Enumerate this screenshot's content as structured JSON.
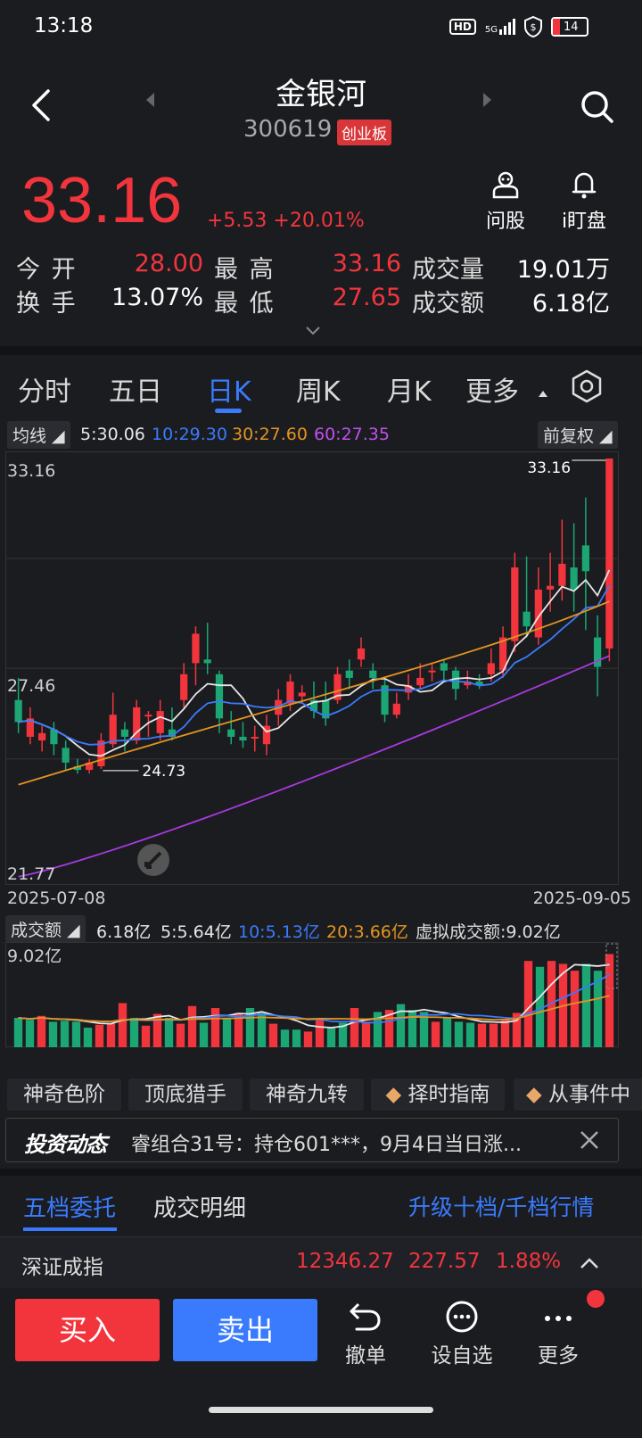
{
  "status": {
    "time": "13:18",
    "hd": "HD",
    "network": "5G",
    "battery": "14"
  },
  "header": {
    "name": "金银河",
    "code": "300619",
    "board": "创业板"
  },
  "price": {
    "last": "33.16",
    "change": "+5.53 +20.01%"
  },
  "actions": {
    "wengu": "问股",
    "dingpan": "i盯盘"
  },
  "quote": {
    "open_label": "今  开",
    "open": "28.00",
    "high_label": "最  高",
    "high": "33.16",
    "volume_label": "成交量",
    "volume": "19.01万",
    "turnover_label": "换  手",
    "turnover": "13.07%",
    "low_label": "最  低",
    "low": "27.65",
    "amount_label": "成交额",
    "amount": "6.18亿"
  },
  "tabs": [
    "分时",
    "五日",
    "日K",
    "周K",
    "月K",
    "更多"
  ],
  "ma": {
    "label": "均线",
    "ma5": "5:30.06",
    "ma10": "10:29.30",
    "ma30": "30:27.60",
    "ma60": "60:27.35",
    "adjust": "前复权"
  },
  "kline": {
    "y_top": "33.16",
    "y_mid": "27.46",
    "y_bottom": "21.77",
    "max_label": "33.16",
    "min_label": "24.73",
    "start_date": "2025-07-08",
    "end_date": "2025-09-05",
    "colors": {
      "up": "#f2353d",
      "down": "#1ba673",
      "ma5": "#e6e6e6",
      "ma10": "#3a7bfd",
      "ma30": "#e39420",
      "ma60": "#a83ae0"
    }
  },
  "volume": {
    "label": "成交额",
    "value": "6.18亿",
    "ma5": "5:5.64亿",
    "ma10": "10:5.13亿",
    "ma20": "20:3.66亿",
    "virtual": "虚拟成交额:9.02亿",
    "y_top": "9.02亿"
  },
  "features": [
    "神奇色阶",
    "顶底猎手",
    "神奇九转",
    "择时指南",
    "从事件中"
  ],
  "news": {
    "logo": "投资动态",
    "text": "睿组合31号：持仓601***，9月4日当日涨..."
  },
  "order_tabs": {
    "tab1": "五档委托",
    "tab2": "成交明细",
    "upgrade": "升级十档/千档行情"
  },
  "index": {
    "name": "深证成指",
    "value": "12346.27",
    "change": "227.57",
    "pct": "1.88%"
  },
  "bottom": {
    "buy": "买入",
    "sell": "卖出",
    "cancel": "撤单",
    "watch": "设自选",
    "more": "更多"
  },
  "chart_data": {
    "type": "candlestick",
    "title": "",
    "x_range": [
      "2025-07-08",
      "2025-09-05"
    ],
    "ylim": [
      21.77,
      33.16
    ],
    "candles": [
      {
        "o": 26.6,
        "c": 26.0,
        "h": 27.2,
        "l": 25.7
      },
      {
        "o": 25.6,
        "c": 26.1,
        "h": 26.4,
        "l": 25.4
      },
      {
        "o": 25.5,
        "c": 25.7,
        "h": 25.9,
        "l": 25.2
      },
      {
        "o": 25.8,
        "c": 25.4,
        "h": 26.0,
        "l": 25.1
      },
      {
        "o": 25.3,
        "c": 24.9,
        "h": 25.5,
        "l": 24.7
      },
      {
        "o": 24.8,
        "c": 24.7,
        "h": 25.0,
        "l": 24.6
      },
      {
        "o": 24.7,
        "c": 24.9,
        "h": 25.0,
        "l": 24.6
      },
      {
        "o": 24.8,
        "c": 25.5,
        "h": 25.7,
        "l": 24.73
      },
      {
        "o": 25.4,
        "c": 26.2,
        "h": 26.8,
        "l": 25.3
      },
      {
        "o": 25.8,
        "c": 25.6,
        "h": 26.0,
        "l": 25.2
      },
      {
        "o": 25.5,
        "c": 26.4,
        "h": 26.6,
        "l": 25.4
      },
      {
        "o": 26.2,
        "c": 26.2,
        "h": 26.3,
        "l": 25.6
      },
      {
        "o": 25.7,
        "c": 26.3,
        "h": 26.6,
        "l": 25.5
      },
      {
        "o": 25.8,
        "c": 25.6,
        "h": 26.4,
        "l": 25.5
      },
      {
        "o": 26.6,
        "c": 27.3,
        "h": 27.6,
        "l": 26.4
      },
      {
        "o": 27.6,
        "c": 28.4,
        "h": 28.6,
        "l": 27.0
      },
      {
        "o": 27.7,
        "c": 27.6,
        "h": 28.7,
        "l": 27.3
      },
      {
        "o": 27.3,
        "c": 26.1,
        "h": 27.4,
        "l": 25.7
      },
      {
        "o": 25.8,
        "c": 25.6,
        "h": 26.3,
        "l": 25.4
      },
      {
        "o": 25.6,
        "c": 25.5,
        "h": 26.0,
        "l": 25.3
      },
      {
        "o": 25.6,
        "c": 25.6,
        "h": 25.9,
        "l": 25.2
      },
      {
        "o": 25.4,
        "c": 25.9,
        "h": 26.2,
        "l": 25.1
      },
      {
        "o": 26.2,
        "c": 26.6,
        "h": 26.9,
        "l": 25.9
      },
      {
        "o": 26.5,
        "c": 27.1,
        "h": 27.3,
        "l": 26.3
      },
      {
        "o": 26.7,
        "c": 26.8,
        "h": 27.0,
        "l": 26.5
      },
      {
        "o": 26.6,
        "c": 26.3,
        "h": 27.1,
        "l": 26.1
      },
      {
        "o": 26.6,
        "c": 26.1,
        "h": 27.1,
        "l": 25.9
      },
      {
        "o": 26.6,
        "c": 27.3,
        "h": 27.5,
        "l": 26.5
      },
      {
        "o": 27.4,
        "c": 27.2,
        "h": 27.7,
        "l": 26.9
      },
      {
        "o": 27.7,
        "c": 28.0,
        "h": 28.3,
        "l": 27.5
      },
      {
        "o": 27.4,
        "c": 27.2,
        "h": 27.6,
        "l": 26.9
      },
      {
        "o": 27.0,
        "c": 26.2,
        "h": 27.2,
        "l": 26.0
      },
      {
        "o": 26.2,
        "c": 26.5,
        "h": 26.8,
        "l": 26.1
      },
      {
        "o": 26.8,
        "c": 27.0,
        "h": 27.3,
        "l": 26.6
      },
      {
        "o": 27.0,
        "c": 27.2,
        "h": 27.6,
        "l": 26.9
      },
      {
        "o": 27.4,
        "c": 27.4,
        "h": 27.6,
        "l": 27.1
      },
      {
        "o": 27.6,
        "c": 27.4,
        "h": 27.7,
        "l": 27.1
      },
      {
        "o": 27.4,
        "c": 26.9,
        "h": 27.5,
        "l": 26.6
      },
      {
        "o": 27.0,
        "c": 27.1,
        "h": 27.4,
        "l": 26.9
      },
      {
        "o": 27.1,
        "c": 27.0,
        "h": 27.3,
        "l": 26.9
      },
      {
        "o": 27.3,
        "c": 27.6,
        "h": 28.0,
        "l": 27.1
      },
      {
        "o": 27.4,
        "c": 28.3,
        "h": 28.6,
        "l": 27.2
      },
      {
        "o": 28.2,
        "c": 30.2,
        "h": 30.6,
        "l": 27.9
      },
      {
        "o": 29.0,
        "c": 28.6,
        "h": 30.5,
        "l": 28.3
      },
      {
        "o": 28.3,
        "c": 29.6,
        "h": 30.2,
        "l": 28.1
      },
      {
        "o": 29.6,
        "c": 29.7,
        "h": 30.6,
        "l": 29.0
      },
      {
        "o": 29.7,
        "c": 30.3,
        "h": 31.5,
        "l": 29.3
      },
      {
        "o": 30.2,
        "c": 29.6,
        "h": 31.4,
        "l": 29.0
      },
      {
        "o": 30.8,
        "c": 30.1,
        "h": 32.1,
        "l": 28.5
      },
      {
        "o": 28.3,
        "c": 27.5,
        "h": 28.9,
        "l": 26.7
      },
      {
        "o": 28.0,
        "c": 33.16,
        "h": 33.16,
        "l": 27.65
      }
    ],
    "volume_bars": [
      {
        "v": 0.3,
        "up": false
      },
      {
        "v": 0.28,
        "up": false
      },
      {
        "v": 0.32,
        "up": true
      },
      {
        "v": 0.26,
        "up": false
      },
      {
        "v": 0.27,
        "up": false
      },
      {
        "v": 0.26,
        "up": false
      },
      {
        "v": 0.2,
        "up": false
      },
      {
        "v": 0.23,
        "up": true
      },
      {
        "v": 0.24,
        "up": true
      },
      {
        "v": 0.45,
        "up": true
      },
      {
        "v": 0.3,
        "up": false
      },
      {
        "v": 0.22,
        "up": true
      },
      {
        "v": 0.34,
        "up": true
      },
      {
        "v": 0.3,
        "up": false
      },
      {
        "v": 0.24,
        "up": true
      },
      {
        "v": 0.42,
        "up": true
      },
      {
        "v": 0.25,
        "up": false
      },
      {
        "v": 0.4,
        "up": true
      },
      {
        "v": 0.3,
        "up": false
      },
      {
        "v": 0.35,
        "up": true
      },
      {
        "v": 0.4,
        "up": false
      },
      {
        "v": 0.36,
        "up": false
      },
      {
        "v": 0.24,
        "up": true
      },
      {
        "v": 0.18,
        "up": false
      },
      {
        "v": 0.18,
        "up": false
      },
      {
        "v": 0.16,
        "up": true
      },
      {
        "v": 0.28,
        "up": true
      },
      {
        "v": 0.2,
        "up": false
      },
      {
        "v": 0.25,
        "up": false
      },
      {
        "v": 0.4,
        "up": true
      },
      {
        "v": 0.26,
        "up": true
      },
      {
        "v": 0.36,
        "up": false
      },
      {
        "v": 0.38,
        "up": true
      },
      {
        "v": 0.44,
        "up": false
      },
      {
        "v": 0.38,
        "up": false
      },
      {
        "v": 0.36,
        "up": false
      },
      {
        "v": 0.26,
        "up": true
      },
      {
        "v": 0.3,
        "up": false
      },
      {
        "v": 0.26,
        "up": false
      },
      {
        "v": 0.25,
        "up": false
      },
      {
        "v": 0.24,
        "up": true
      },
      {
        "v": 0.24,
        "up": true
      },
      {
        "v": 0.28,
        "up": true
      },
      {
        "v": 0.35,
        "up": true
      },
      {
        "v": 0.88,
        "up": true
      },
      {
        "v": 0.82,
        "up": false
      },
      {
        "v": 0.88,
        "up": true
      },
      {
        "v": 0.85,
        "up": true
      },
      {
        "v": 0.78,
        "up": true
      },
      {
        "v": 0.85,
        "up": false
      },
      {
        "v": 0.78,
        "up": false
      },
      {
        "v": 0.95,
        "up": true
      }
    ]
  }
}
